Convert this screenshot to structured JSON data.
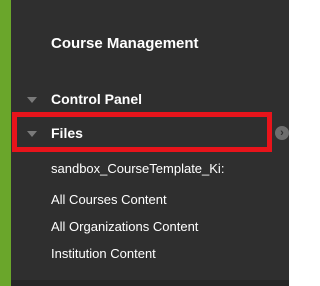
{
  "sidebar": {
    "heading": "Course Management",
    "control_panel_label": "Control Panel",
    "files_label": "Files",
    "files_expand_icon": "arrow-circle-icon",
    "items": [
      {
        "label": "sandbox_CourseTemplate_Ki:"
      },
      {
        "label": "All Courses Content"
      },
      {
        "label": "All Organizations Content"
      },
      {
        "label": "Institution Content"
      }
    ]
  },
  "colors": {
    "panel_bg": "#2f2f2f",
    "accent_green": "#6aa62b",
    "highlight_red": "#e8141b"
  }
}
